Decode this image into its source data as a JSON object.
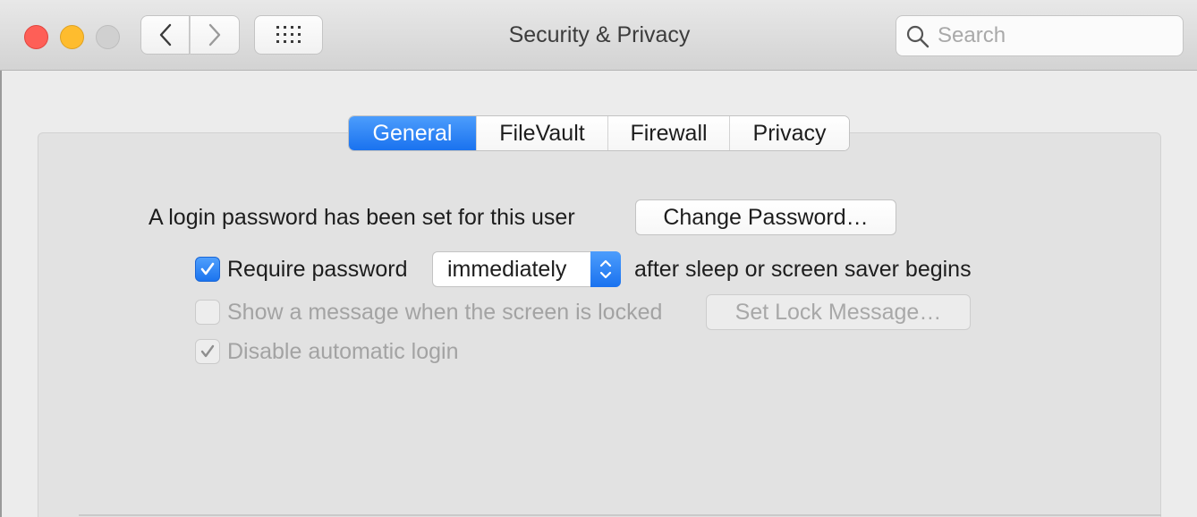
{
  "window": {
    "title": "Security & Privacy"
  },
  "toolbar": {
    "back_icon": "chevron-left-icon",
    "forward_icon": "chevron-right-icon",
    "show_all_icon": "grid-icon"
  },
  "search": {
    "placeholder": "Search",
    "value": ""
  },
  "tabs": [
    {
      "label": "General",
      "active": true
    },
    {
      "label": "FileVault",
      "active": false
    },
    {
      "label": "Firewall",
      "active": false
    },
    {
      "label": "Privacy",
      "active": false
    }
  ],
  "general": {
    "login_password_text": "A login password has been set for this user",
    "change_password_label": "Change Password…",
    "require_password": {
      "checked": true,
      "label": "Require password",
      "selected_option": "immediately",
      "suffix": "after sleep or screen saver begins"
    },
    "show_message": {
      "checked": false,
      "enabled": false,
      "label": "Show a message when the screen is locked",
      "button_label": "Set Lock Message…"
    },
    "disable_auto_login": {
      "checked": true,
      "enabled": false,
      "label": "Disable automatic login"
    }
  },
  "colors": {
    "accent": "#1a72ef",
    "close": "#fe5f57",
    "minimize": "#febc2e",
    "zoom_inactive": "#d0d0d0"
  }
}
